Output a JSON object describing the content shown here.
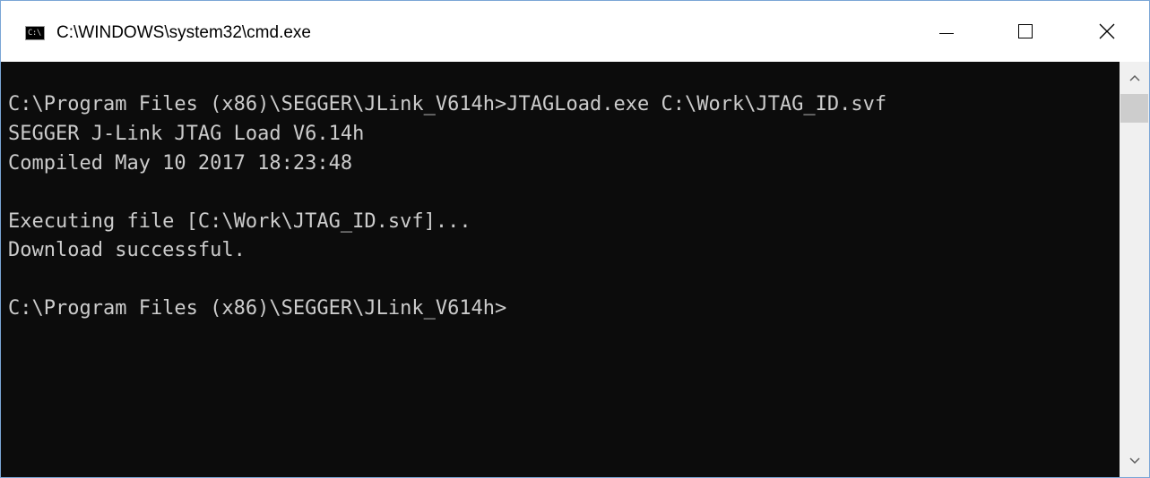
{
  "window": {
    "title": "C:\\WINDOWS\\system32\\cmd.exe",
    "icon": "cmd-icon",
    "icon_text": "C:\\",
    "controls": {
      "minimize": "minimize-icon",
      "maximize": "maximize-icon",
      "close": "close-icon"
    }
  },
  "console": {
    "lines": [
      "C:\\Program Files (x86)\\SEGGER\\JLink_V614h>JTAGLoad.exe C:\\Work\\JTAG_ID.svf",
      "SEGGER J-Link JTAG Load V6.14h",
      "Compiled May 10 2017 18:23:48",
      "",
      "Executing file [C:\\Work\\JTAG_ID.svf]...",
      "Download successful.",
      "",
      "C:\\Program Files (x86)\\SEGGER\\JLink_V614h>"
    ]
  },
  "scrollbar": {
    "up": "chevron-up-icon",
    "down": "chevron-down-icon"
  },
  "colors": {
    "console_bg": "#0c0c0c",
    "console_text": "#cccccc",
    "window_border": "#7aa6d6"
  }
}
